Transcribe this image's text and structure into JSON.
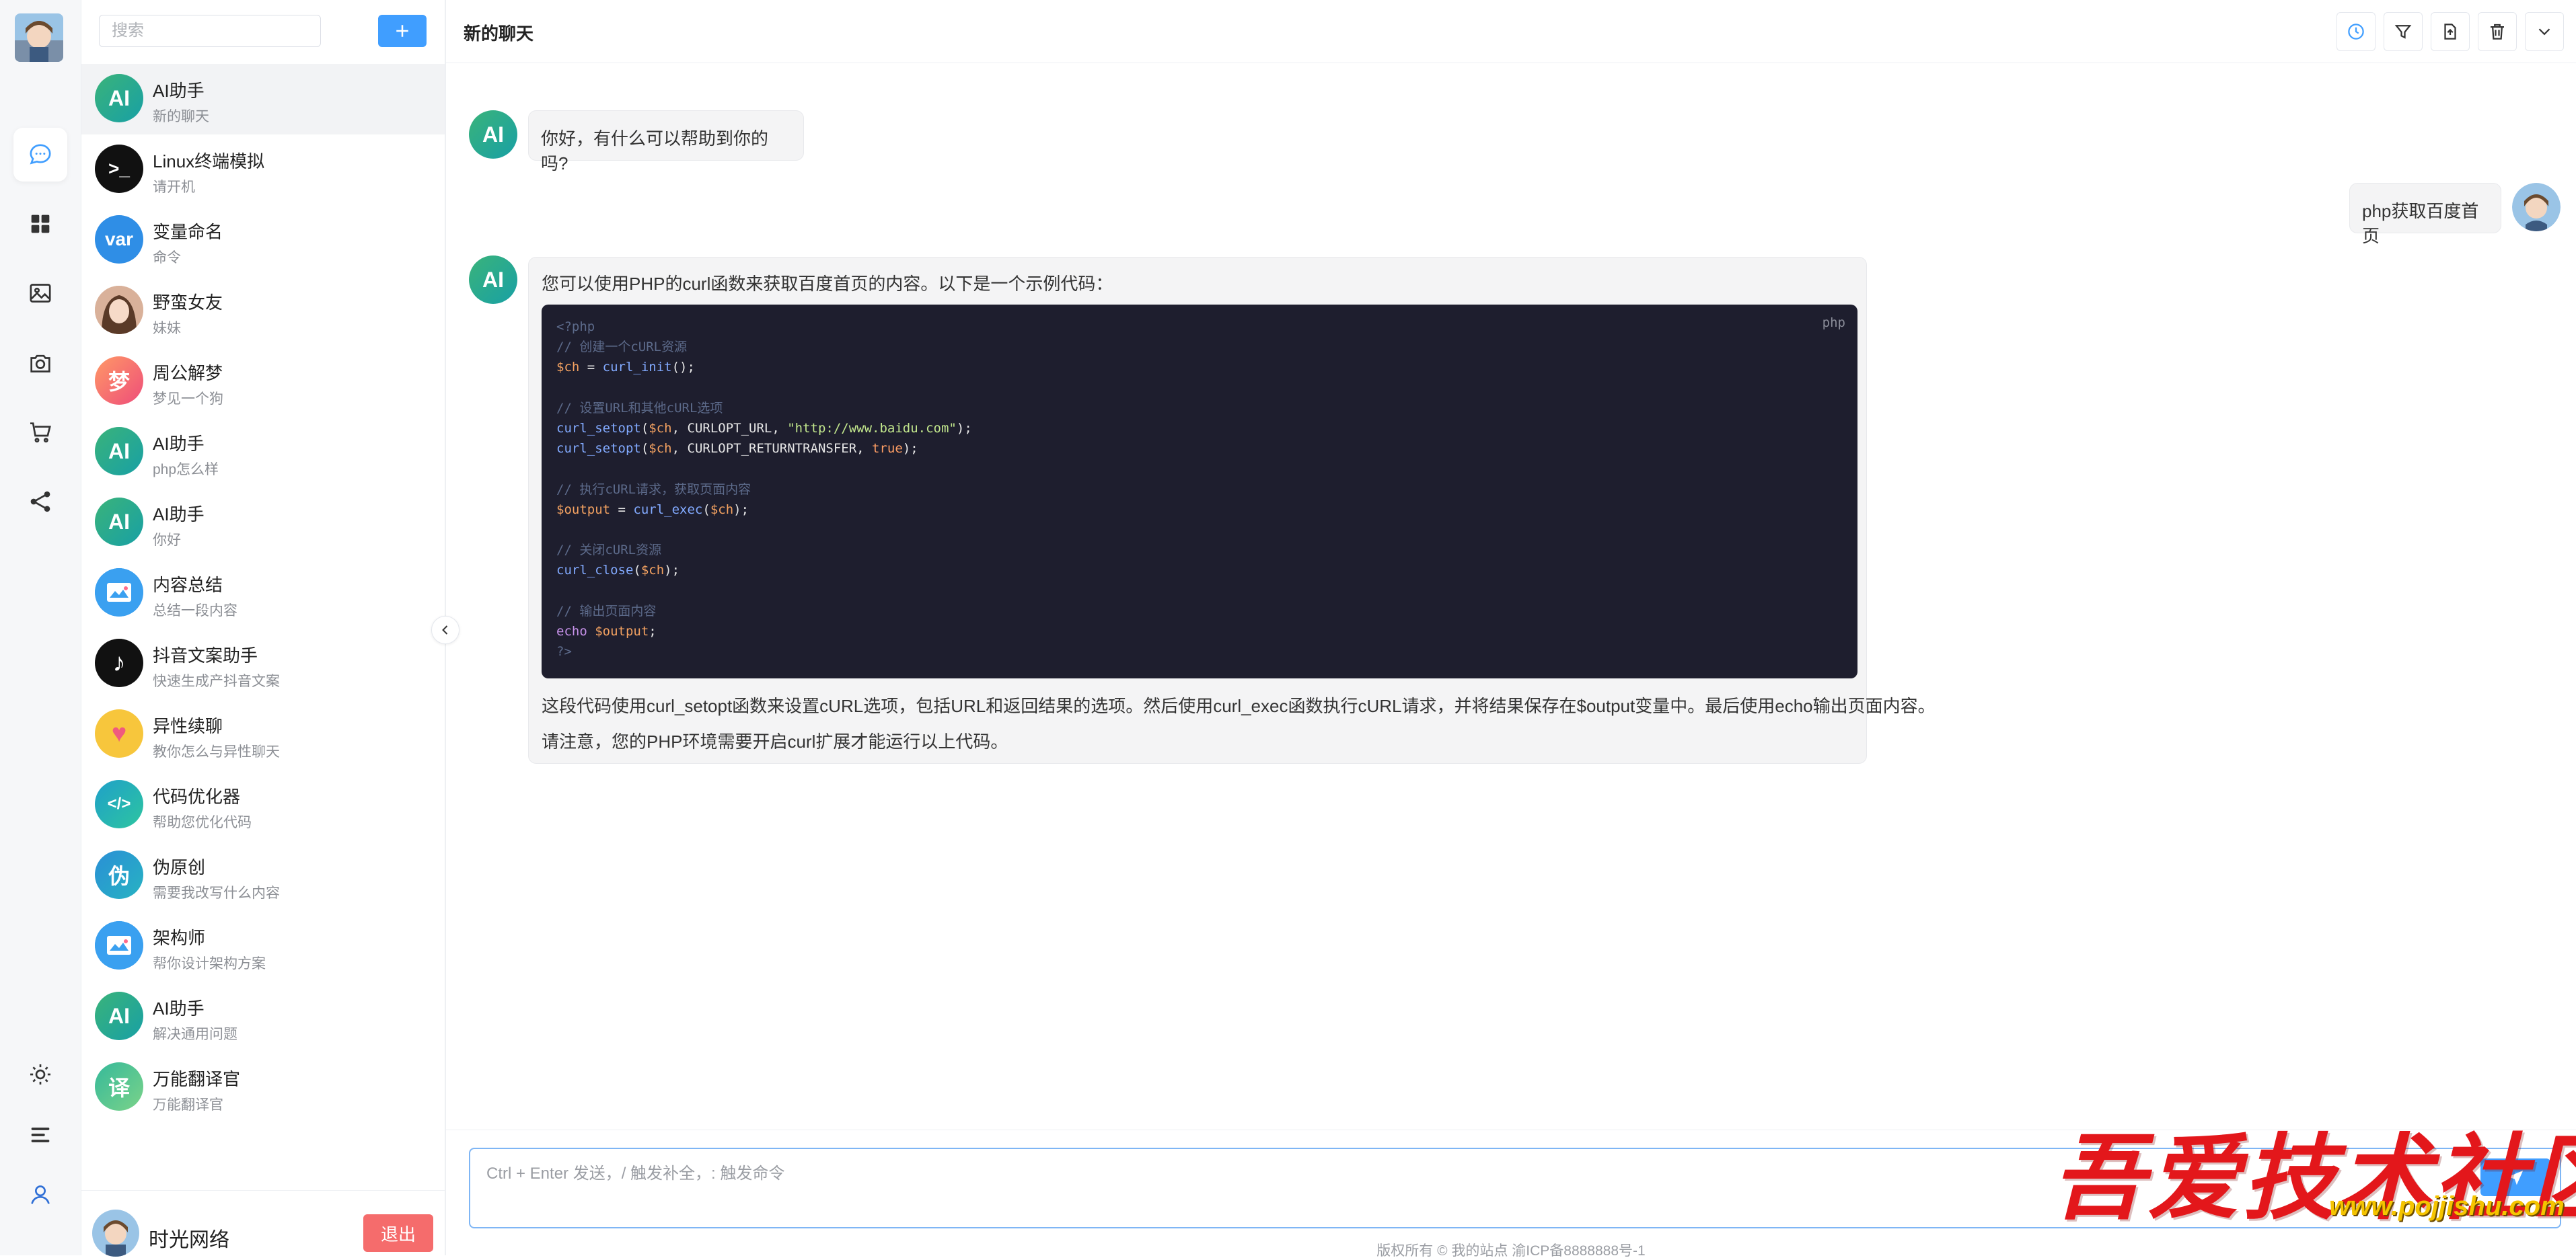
{
  "rail": {
    "items": [
      {
        "name": "chat",
        "icon": "chat-bubble-icon",
        "active": true
      },
      {
        "name": "apps",
        "icon": "grid-icon",
        "active": false
      },
      {
        "name": "images",
        "icon": "image-icon",
        "active": false
      },
      {
        "name": "camera",
        "icon": "camera-icon",
        "active": false
      },
      {
        "name": "shop",
        "icon": "cart-icon",
        "active": false
      },
      {
        "name": "share",
        "icon": "share-icon",
        "active": false
      }
    ],
    "bottom": [
      {
        "name": "theme",
        "icon": "sun-icon"
      },
      {
        "name": "menu",
        "icon": "menu-icon"
      },
      {
        "name": "profile",
        "icon": "user-icon"
      }
    ]
  },
  "sidebar": {
    "search_placeholder": "搜索",
    "add_label": "+",
    "chats": [
      {
        "title": "AI助手",
        "subtitle": "新的聊天",
        "avatar_text": "AI",
        "avatar_color": "#2bb07f",
        "active": true
      },
      {
        "title": "Linux终端模拟",
        "subtitle": "请开机",
        "avatar_text": ">_",
        "avatar_color": "#111111",
        "active": false
      },
      {
        "title": "变量命名",
        "subtitle": "命令",
        "avatar_text": "var",
        "avatar_color": "#2f8ee6",
        "active": false
      },
      {
        "title": "野蛮女友",
        "subtitle": "妹妹",
        "avatar_text": "",
        "avatar_color": "#d9a58e",
        "active": false
      },
      {
        "title": "周公解梦",
        "subtitle": "梦见一个狗",
        "avatar_text": "梦",
        "avatar_color": "#f0657a",
        "active": false
      },
      {
        "title": "AI助手",
        "subtitle": "php怎么样",
        "avatar_text": "AI",
        "avatar_color": "#2bb07f",
        "active": false
      },
      {
        "title": "AI助手",
        "subtitle": "你好",
        "avatar_text": "AI",
        "avatar_color": "#2bb07f",
        "active": false
      },
      {
        "title": "内容总结",
        "subtitle": "总结一段内容",
        "avatar_text": "",
        "avatar_color": "#3aa0f0",
        "active": false
      },
      {
        "title": "抖音文案助手",
        "subtitle": "快速生成产抖音文案",
        "avatar_text": "♪",
        "avatar_color": "#111111",
        "active": false
      },
      {
        "title": "异性续聊",
        "subtitle": "教你怎么与异性聊天",
        "avatar_text": "♥",
        "avatar_color": "#f7c63c",
        "active": false
      },
      {
        "title": "代码优化器",
        "subtitle": "帮助您优化代码",
        "avatar_text": "</>",
        "avatar_color": "#1fa0c9",
        "active": false
      },
      {
        "title": "伪原创",
        "subtitle": "需要我改写什么内容",
        "avatar_text": "伪",
        "avatar_color": "#2a8fd6",
        "active": false
      },
      {
        "title": "架构师",
        "subtitle": "帮你设计架构方案",
        "avatar_text": "",
        "avatar_color": "#3aa0f0",
        "active": false
      },
      {
        "title": "AI助手",
        "subtitle": "解决通用问题",
        "avatar_text": "AI",
        "avatar_color": "#2bb07f",
        "active": false
      },
      {
        "title": "万能翻译官",
        "subtitle": "万能翻译官",
        "avatar_text": "译",
        "avatar_color": "#35b99a",
        "active": false
      }
    ],
    "user_name": "时光网络",
    "logout_label": "退出"
  },
  "header": {
    "title": "新的聊天",
    "tools": [
      "clock-icon",
      "filter-icon",
      "export-icon",
      "trash-icon",
      "chevron-down-icon"
    ]
  },
  "messages": {
    "greeting": "你好，有什么可以帮助到你的吗?",
    "user_question": "php获取百度首页",
    "reply_intro": "您可以使用PHP的curl函数来获取百度首页的内容。以下是一个示例代码：",
    "code_lang": "php",
    "code_lines": [
      "<?php",
      "// 创建一个cURL资源",
      "$ch = curl_init();",
      "",
      "// 设置URL和其他cURL选项",
      "curl_setopt($ch, CURLOPT_URL, \"http://www.baidu.com\");",
      "curl_setopt($ch, CURLOPT_RETURNTRANSFER, true);",
      "",
      "// 执行cURL请求，获取页面内容",
      "$output = curl_exec($ch);",
      "",
      "// 关闭cURL资源",
      "curl_close($ch);",
      "",
      "// 输出页面内容",
      "echo $output;",
      "?>"
    ],
    "reply_outro_1": "这段代码使用curl_setopt函数来设置cURL选项，包括URL和返回结果的选项。然后使用curl_exec函数执行cURL请求，并将结果保存在$output变量中。最后使用echo输出页面内容。",
    "reply_outro_2": "请注意，您的PHP环境需要开启curl扩展才能运行以上代码。",
    "ai_avatar_text": "AI"
  },
  "input": {
    "placeholder": "Ctrl + Enter 发送，/ 触发补全，: 触发命令"
  },
  "footer": {
    "text": "版权所有 © 我的站点 渝ICP备8888888号-1"
  },
  "watermark": {
    "title": "吾爱技术社区",
    "url": "www.pojjishu.com"
  },
  "colors": {
    "primary": "#409eff",
    "danger": "#f56c6c",
    "ai_gradient_start": "#3ab37a",
    "ai_gradient_end": "#18a0a5"
  }
}
